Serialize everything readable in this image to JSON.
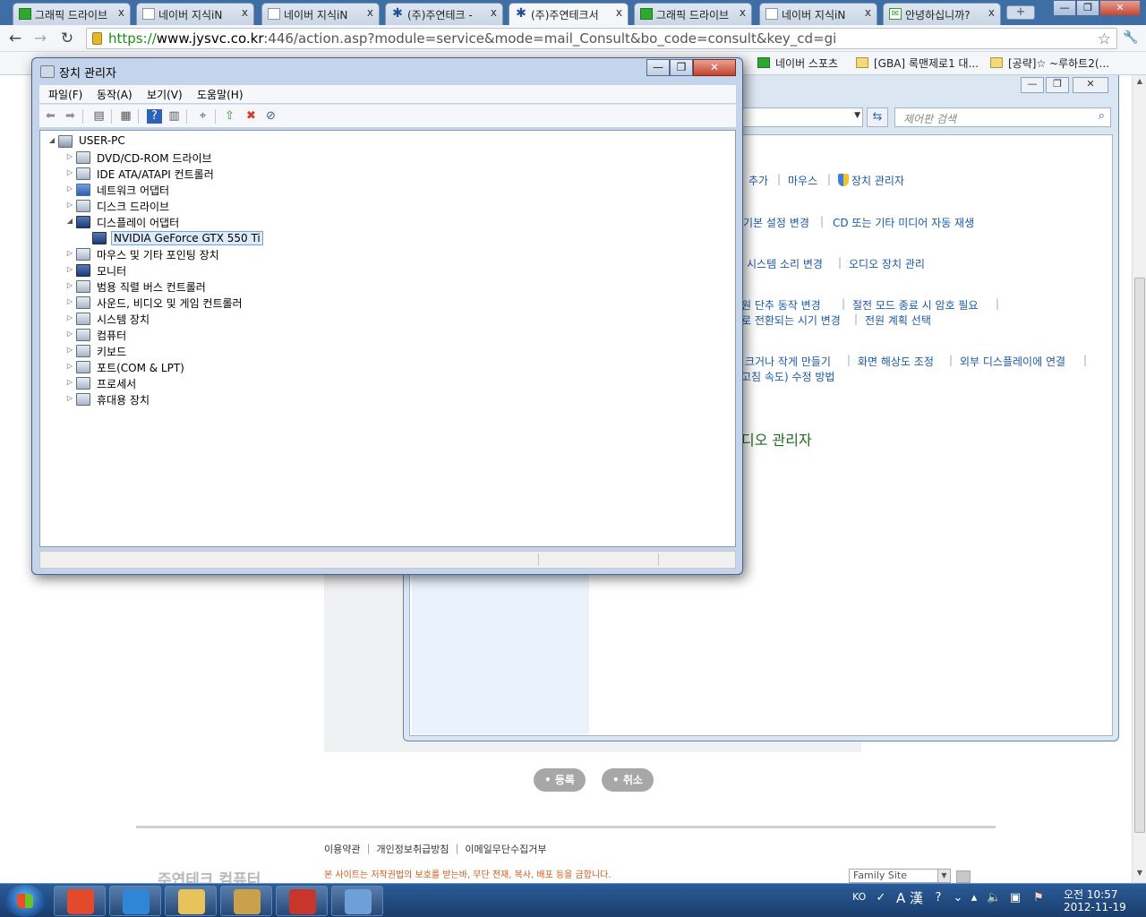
{
  "browser": {
    "tabs": [
      {
        "title": "그래픽 드라이브",
        "icon": "green-site-icon"
      },
      {
        "title": "네이버 지식iN",
        "icon": "page-icon"
      },
      {
        "title": "네이버 지식iN",
        "icon": "page-icon"
      },
      {
        "title": "(주)주연테크 -",
        "icon": "jooyon-logo-icon"
      },
      {
        "title": "(주)주연테크서",
        "icon": "jooyon-logo-icon"
      },
      {
        "title": "그래픽 드라이브",
        "icon": "green-site-icon"
      },
      {
        "title": "네이버 지식iN",
        "icon": "page-icon"
      },
      {
        "title": "안녕하십니까?",
        "icon": "mail-icon"
      }
    ],
    "tab_close": "x",
    "new_tab": "+",
    "window_buttons": {
      "minimize": "—",
      "restore": "❐",
      "close": "✕"
    },
    "url": {
      "scheme": "https://",
      "host": "www.jysvc.co.kr",
      "rest": ":446/action.asp?module=service&mode=mail_Consult&bo_code=consult&key_cd=gi"
    },
    "bookmarks": [
      {
        "label": "네이버 스포츠",
        "icon": "naver-icon"
      },
      {
        "label": "[GBA] 록맨제로1 대...",
        "icon": "folder-icon"
      },
      {
        "label": "[공략]☆ ~루하트2(...",
        "icon": "folder-icon"
      }
    ]
  },
  "control_panel": {
    "search_placeholder": "제어판 검색",
    "links": {
      "add": "추가",
      "mouse": "마우스",
      "device_manager": "장치 관리자",
      "default_settings": "기본 설정 변경",
      "autoplay": "CD 또는 기타 미디어 자동 재생",
      "system_sounds": "시스템 소리 변경",
      "audio_devices": "오디오 장치 관리",
      "power_button": "원 단추 동작 변경",
      "wake_password": "절전 모드 종료 시 암호 필요",
      "sleep_timing": "로 전환되는 시기 변경",
      "power_plan": "전원 계획 선택",
      "text_size": "크거나 작게 만들기",
      "resolution": "화면 해상도 조정",
      "external_display": "외부 디스플레이에 연결",
      "refresh_rate": "고침 속도) 수정 방법"
    },
    "heading": "디오 관리자"
  },
  "webpage": {
    "buttons": {
      "submit": "• 등록",
      "cancel": "• 취소"
    },
    "footer_links": "이용약관  ｜  개인정보취급방침  ｜  이메일무단수집거부",
    "footer_notice": "본 사이트는 저작권법의 보호를 받는바, 무단 전재, 복사, 배포 등을 금합니다.",
    "footer_logo": "주연테크 컴퓨터",
    "family_site": "Family Site"
  },
  "device_manager": {
    "title": "장치 관리자",
    "menu": [
      "파일(F)",
      "동작(A)",
      "보기(V)",
      "도움말(H)"
    ],
    "root": "USER-PC",
    "categories": [
      {
        "label": "DVD/CD-ROM 드라이브",
        "expanded": false
      },
      {
        "label": "IDE ATA/ATAPI 컨트롤러",
        "expanded": false
      },
      {
        "label": "네트워크 어댑터",
        "expanded": false
      },
      {
        "label": "디스크 드라이브",
        "expanded": false
      },
      {
        "label": "디스플레이 어댑터",
        "expanded": true
      },
      {
        "label": "NVIDIA GeForce GTX 550 Ti",
        "child": true,
        "selected": true
      },
      {
        "label": "마우스 및 기타 포인팅 장치",
        "expanded": false
      },
      {
        "label": "모니터",
        "expanded": false
      },
      {
        "label": "범용 직렬 버스 컨트롤러",
        "expanded": false
      },
      {
        "label": "사운드, 비디오 및 게임 컨트롤러",
        "expanded": false
      },
      {
        "label": "시스템 장치",
        "expanded": false
      },
      {
        "label": "컴퓨터",
        "expanded": false
      },
      {
        "label": "키보드",
        "expanded": false
      },
      {
        "label": "포트(COM & LPT)",
        "expanded": false
      },
      {
        "label": "프로세서",
        "expanded": false
      },
      {
        "label": "휴대용 장치",
        "expanded": false
      }
    ]
  },
  "taskbar": {
    "apps": [
      {
        "name": "chrome",
        "color": "#e24a2b"
      },
      {
        "name": "internet-explorer",
        "color": "#2f86d6"
      },
      {
        "name": "explorer",
        "color": "#e8c25a"
      },
      {
        "name": "paint",
        "color": "#c9a04c"
      },
      {
        "name": "toolbox",
        "color": "#c8362b"
      },
      {
        "name": "control-panel",
        "color": "#6f9fd8"
      }
    ],
    "ime_lang": "KO",
    "ime_mode": "A 漢",
    "time": "오전 10:57",
    "date": "2012-11-19"
  }
}
